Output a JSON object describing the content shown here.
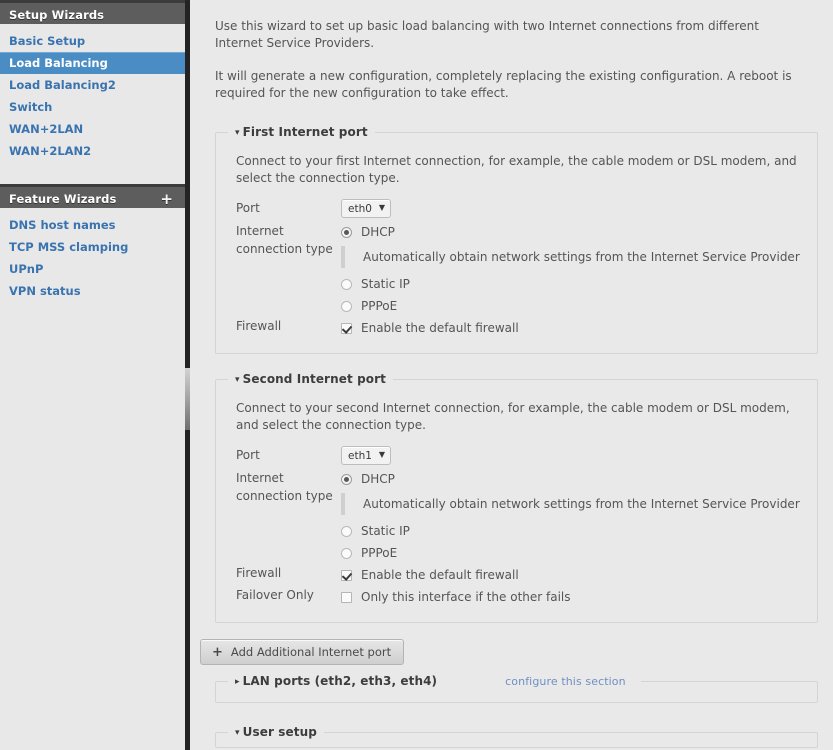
{
  "sidebar": {
    "setup_wizards": {
      "title": "Setup Wizards",
      "items": [
        {
          "label": "Basic Setup",
          "active": false
        },
        {
          "label": "Load Balancing",
          "active": true
        },
        {
          "label": "Load Balancing2",
          "active": false
        },
        {
          "label": "Switch",
          "active": false
        },
        {
          "label": "WAN+2LAN",
          "active": false
        },
        {
          "label": "WAN+2LAN2",
          "active": false
        }
      ]
    },
    "feature_wizards": {
      "title": "Feature Wizards",
      "add_icon": "+",
      "items": [
        {
          "label": "DNS host names"
        },
        {
          "label": "TCP MSS clamping"
        },
        {
          "label": "UPnP"
        },
        {
          "label": "VPN status"
        }
      ]
    }
  },
  "intro": {
    "paragraph1": "Use this wizard to set up basic load balancing with two Internet connections from different Internet Service Providers.",
    "paragraph2": "It will generate a new configuration, completely replacing the existing configuration. A reboot is required for the new configuration to take effect."
  },
  "first_port": {
    "legend": "First Internet port",
    "caret": "▾",
    "description": "Connect to your first Internet connection, for example, the cable modem or DSL modem, and select the connection type.",
    "port_label": "Port",
    "port_value": "eth0",
    "port_caret": "▼",
    "conn_label_line1": "Internet",
    "conn_label_line2": "connection type",
    "options": [
      {
        "label": "DHCP",
        "checked": true
      },
      {
        "label": "Static IP",
        "checked": false
      },
      {
        "label": "PPPoE",
        "checked": false
      }
    ],
    "dhcp_description": "Automatically obtain network settings from the Internet Service Provider",
    "firewall_label": "Firewall",
    "firewall_option": "Enable the default firewall",
    "firewall_checked": true
  },
  "second_port": {
    "legend": "Second Internet port",
    "caret": "▾",
    "description": "Connect to your second Internet connection, for example, the cable modem or DSL modem, and select the connection type.",
    "port_label": "Port",
    "port_value": "eth1",
    "port_caret": "▼",
    "conn_label_line1": "Internet",
    "conn_label_line2": "connection type",
    "options": [
      {
        "label": "DHCP",
        "checked": true
      },
      {
        "label": "Static IP",
        "checked": false
      },
      {
        "label": "PPPoE",
        "checked": false
      }
    ],
    "dhcp_description": "Automatically obtain network settings from the Internet Service Provider",
    "firewall_label": "Firewall",
    "firewall_option": "Enable the default firewall",
    "firewall_checked": true,
    "failover_label": "Failover Only",
    "failover_option": "Only this interface if the other fails",
    "failover_checked": false
  },
  "add_port_button": {
    "icon": "+",
    "label": "Add Additional Internet port"
  },
  "lan_ports": {
    "legend": "LAN ports (eth2, eth3, eth4)",
    "caret": "▸",
    "link": "configure this section"
  },
  "user_setup": {
    "legend": "User setup",
    "caret": "▾"
  },
  "colors": {
    "accent_blue": "#4a8dc4",
    "link_blue": "#3a74b0",
    "panel_header": "#5d5d5d",
    "page_bg": "#e9e9e9"
  }
}
